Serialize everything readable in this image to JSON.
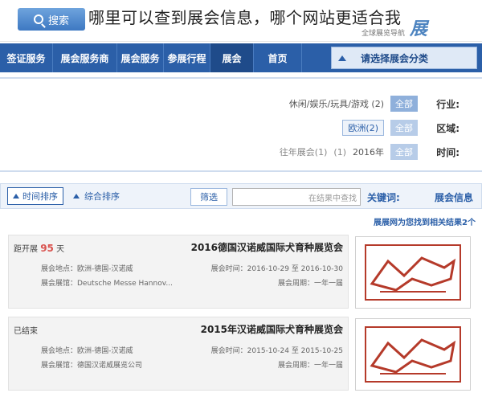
{
  "question": "哪里可以查到展会信息，哪个网站更适合我",
  "header": {
    "search_button": "搜索",
    "logo_subtitle": "全球展览导航",
    "logo_text": "展"
  },
  "nav": {
    "items": [
      "签证服务",
      "展会服务商",
      "展会服务",
      "参展行程",
      "展会",
      "首页"
    ],
    "active_index": 4,
    "category_label": "请选择展会分类"
  },
  "filters": {
    "industry": {
      "label": "行业:",
      "all": "全部",
      "options": "休闲/娱乐/玩具/游戏 (2)"
    },
    "region": {
      "label": "区域:",
      "all": "全部",
      "options": "欧洲(2)"
    },
    "time": {
      "label": "时间:",
      "all": "全部",
      "options": [
        "2016年",
        "(1)",
        "往年展会(1)"
      ]
    }
  },
  "results_bar": {
    "sort_time": "时间排序",
    "sort_combined": "综合排序",
    "filter_button": "筛选",
    "keyword_placeholder": "在结果中查找",
    "keyword_label": "关键词:",
    "section_title": "展会信息"
  },
  "result_note": "展展网为您找到相关结果2个",
  "results": [
    {
      "title": "2016德国汉诺威国际犬育种展览会",
      "status_prefix": "距开展",
      "status_days": "95",
      "status_suffix": "天",
      "time": "展会时间：2016-10-29 至 2016-10-30",
      "cycle": "展会周期：一年一届",
      "location": "展会地点：欧洲-德国-汉诺威",
      "venue": "展会展馆：Deutsche Messe Hannov..."
    },
    {
      "title": "2015年汉诺威国际犬育种展览会",
      "status": "已结束",
      "time": "展会时间：2015-10-24 至 2015-10-25",
      "cycle": "展会周期：一年一届",
      "location": "展会地点：欧洲-德国-汉诺威",
      "venue": "展会展馆：德国汉诺威展览公司"
    }
  ],
  "colors": {
    "nav": "#2b5fa8",
    "accent": "#2b5fa8",
    "days": "#d9534f"
  }
}
